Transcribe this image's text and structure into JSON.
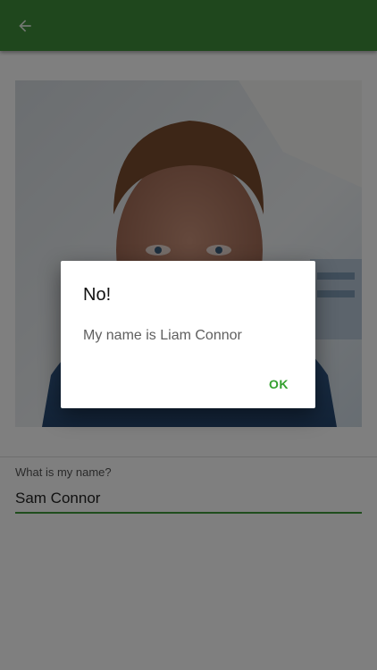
{
  "theme": {
    "primary": "#3e8f3a",
    "accent": "#34a02f",
    "scrim": "rgba(0,0,0,0.5)"
  },
  "appbar": {
    "back_icon": "arrow-back-icon"
  },
  "photo": {
    "subject": "portrait-photo"
  },
  "form": {
    "label": "What is my name?",
    "value": "Sam Connor"
  },
  "dialog": {
    "title": "No!",
    "message": "My name is Liam Connor",
    "ok_label": "OK"
  }
}
